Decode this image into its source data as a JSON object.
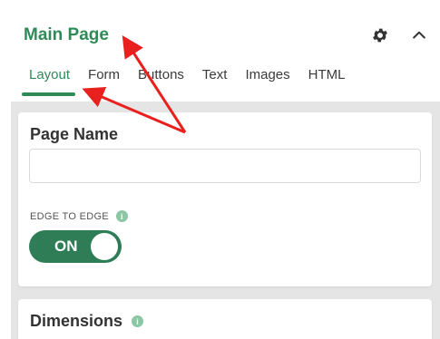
{
  "header": {
    "title": "Main Page",
    "settings_icon": "gear-icon",
    "collapse_icon": "chevron-up-icon"
  },
  "tabs": [
    {
      "label": "Layout",
      "active": true
    },
    {
      "label": "Form",
      "active": false
    },
    {
      "label": "Buttons",
      "active": false
    },
    {
      "label": "Text",
      "active": false
    },
    {
      "label": "Images",
      "active": false
    },
    {
      "label": "HTML",
      "active": false
    }
  ],
  "page_name_card": {
    "title": "Page Name",
    "input_value": "",
    "edge_label": "EDGE TO EDGE",
    "info_glyph": "i",
    "toggle_label": "ON",
    "toggle_on": true
  },
  "dimensions_card": {
    "title": "Dimensions",
    "info_glyph": "i"
  },
  "colors": {
    "accent": "#2e8b57",
    "toggle": "#2e7d57",
    "annotation_arrow": "#e8201e",
    "panel_bg": "#e5e5e5"
  }
}
